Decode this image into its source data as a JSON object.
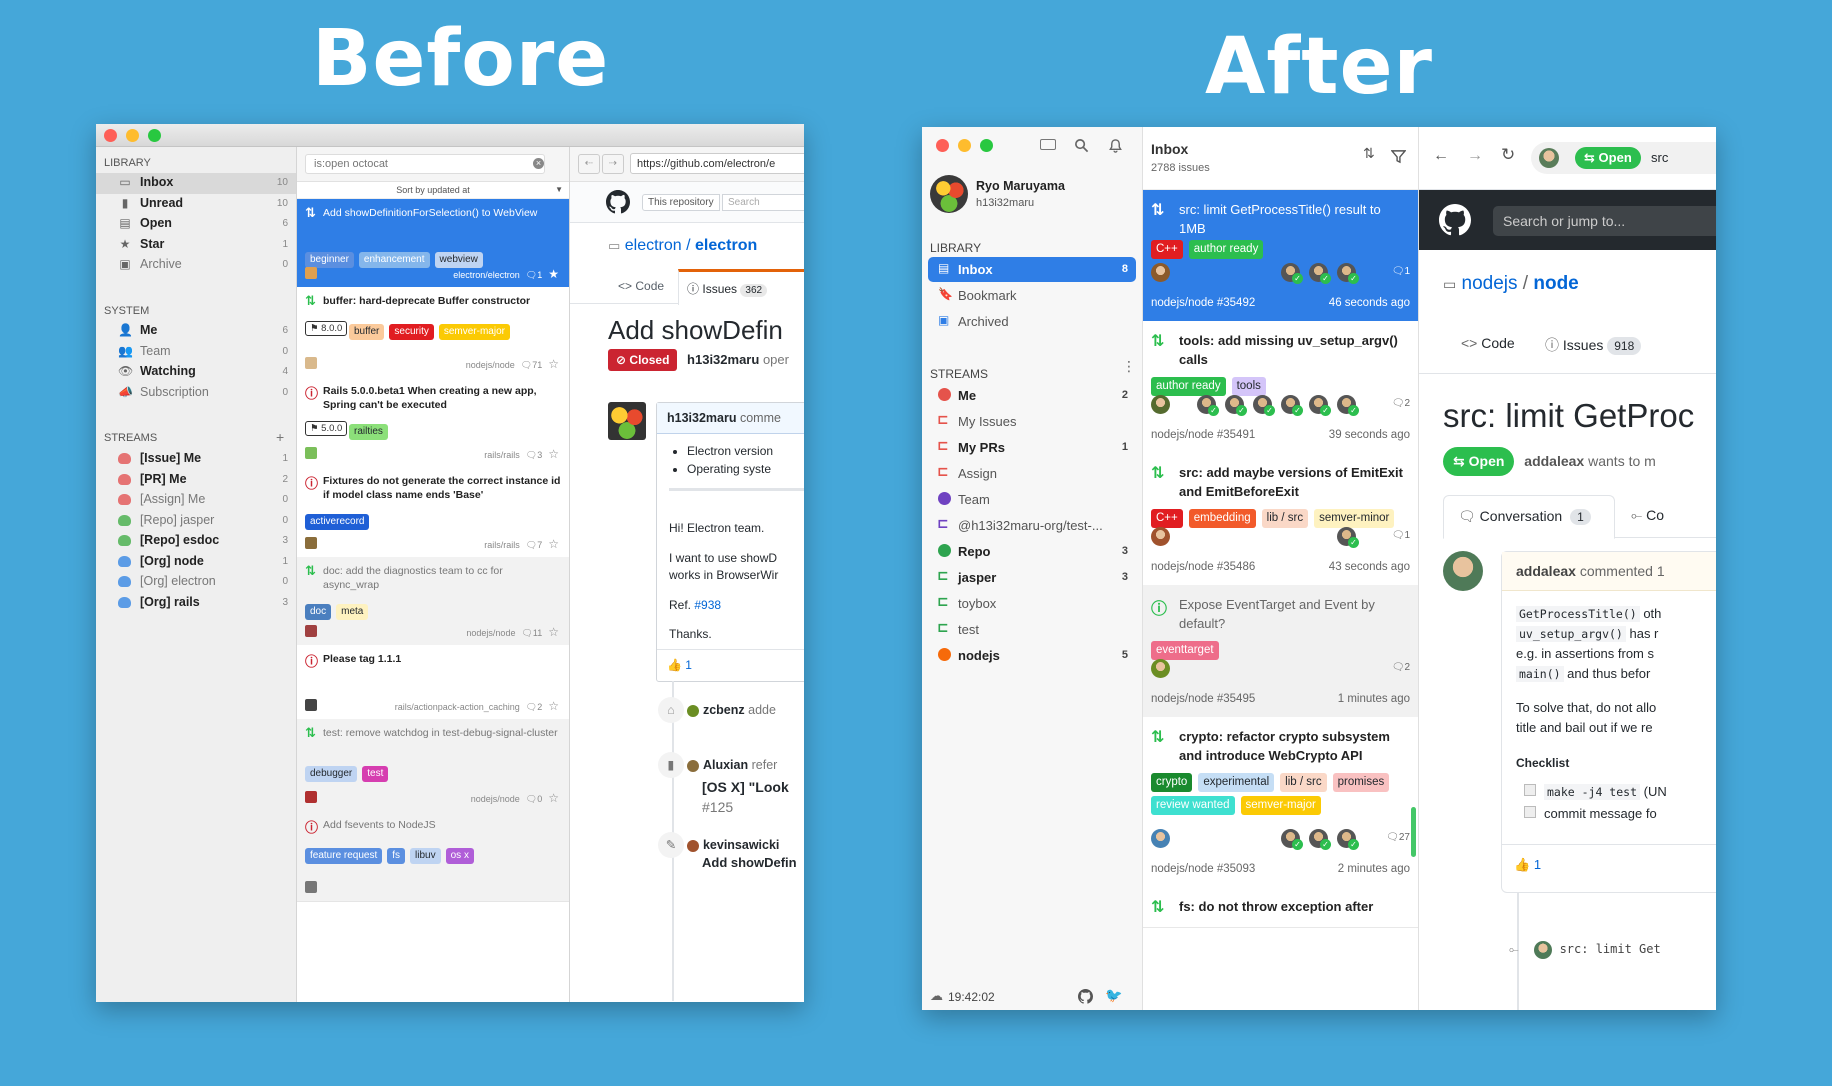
{
  "titles": {
    "before": "Before",
    "after": "After"
  },
  "before": {
    "sidebar": {
      "library_header": "LIBRARY",
      "library": [
        {
          "label": "Inbox",
          "count": "10",
          "bold": true,
          "selected": true
        },
        {
          "label": "Unread",
          "count": "10",
          "bold": true
        },
        {
          "label": "Open",
          "count": "6",
          "bold": true
        },
        {
          "label": "Star",
          "count": "1",
          "bold": true
        },
        {
          "label": "Archive",
          "count": "0",
          "bold": false
        }
      ],
      "system_header": "SYSTEM",
      "system": [
        {
          "label": "Me",
          "count": "6",
          "bold": true
        },
        {
          "label": "Team",
          "count": "0",
          "bold": false
        },
        {
          "label": "Watching",
          "count": "4",
          "bold": true
        },
        {
          "label": "Subscription",
          "count": "0",
          "bold": false
        }
      ],
      "streams_header": "STREAMS",
      "streams_add": "+",
      "streams": [
        {
          "label": "[Issue] Me",
          "count": "1",
          "bold": true,
          "color": "#e57373"
        },
        {
          "label": "[PR] Me",
          "count": "2",
          "bold": true,
          "color": "#e57373"
        },
        {
          "label": "[Assign] Me",
          "count": "0",
          "bold": false,
          "color": "#e57373"
        },
        {
          "label": "[Repo] jasper",
          "count": "0",
          "bold": false,
          "color": "#66bb6a"
        },
        {
          "label": "[Repo] esdoc",
          "count": "3",
          "bold": true,
          "color": "#66bb6a"
        },
        {
          "label": "[Org] node",
          "count": "1",
          "bold": true,
          "color": "#5c9ce6"
        },
        {
          "label": "[Org] electron",
          "count": "0",
          "bold": false,
          "color": "#5c9ce6"
        },
        {
          "label": "[Org] rails",
          "count": "3",
          "bold": true,
          "color": "#5c9ce6"
        }
      ]
    },
    "list": {
      "search_value": "is:open octocat",
      "sort_label": "Sort by updated at",
      "items": [
        {
          "title": "Add showDefinitionForSelection() to WebView",
          "selected": true,
          "labels": [
            {
              "t": "beginner",
              "c": "#5b8fe0"
            },
            {
              "t": "enhancement",
              "c": "#84b6eb"
            },
            {
              "t": "webview",
              "c": "#bfd4f2",
              "fg": "#24292e"
            }
          ],
          "repo": "electron/electron",
          "comments": "1",
          "state": "pr"
        },
        {
          "title": "buffer: hard-deprecate Buffer constructor",
          "milestone": "8.0.0",
          "labels": [
            {
              "t": "buffer",
              "c": "#fbca9b",
              "fg": "#24292e"
            },
            {
              "t": "security",
              "c": "#e11d21"
            },
            {
              "t": "semver-major",
              "c": "#fbca04"
            }
          ],
          "repo": "nodejs/node",
          "comments": "71",
          "state": "pr"
        },
        {
          "title": "Rails 5.0.0.beta1 When creating a new app, Spring can't be executed",
          "milestone": "5.0.0",
          "labels": [
            {
              "t": "railties",
              "c": "#8ce07a",
              "fg": "#24292e"
            }
          ],
          "repo": "rails/rails",
          "comments": "3",
          "state": "issue"
        },
        {
          "title": "Fixtures do not generate the correct instance id if model class name ends 'Base'",
          "labels": [
            {
              "t": "activerecord",
              "c": "#1f5fd6"
            }
          ],
          "repo": "rails/rails",
          "comments": "7",
          "state": "issue"
        },
        {
          "title": "doc: add the diagnostics team to cc for async_wrap",
          "read": true,
          "labels": [
            {
              "t": "doc",
              "c": "#4b7fbf"
            },
            {
              "t": "meta",
              "c": "#fef2c0",
              "fg": "#24292e"
            }
          ],
          "repo": "nodejs/node",
          "comments": "11",
          "state": "pr"
        },
        {
          "title": "Please tag 1.1.1",
          "labels": [],
          "repo": "rails/actionpack-action_caching",
          "comments": "2",
          "state": "issue"
        },
        {
          "title": "test: remove watchdog in test-debug-signal-cluster",
          "read": true,
          "labels": [
            {
              "t": "debugger",
              "c": "#bfd4f2",
              "fg": "#24292e"
            },
            {
              "t": "test",
              "c": "#d63eb0"
            }
          ],
          "repo": "nodejs/node",
          "comments": "0",
          "state": "pr"
        },
        {
          "title": "Add fsevents to NodeJS",
          "read": true,
          "labels": [
            {
              "t": "feature request",
              "c": "#5b8fe0"
            },
            {
              "t": "fs",
              "c": "#5b8fe0"
            },
            {
              "t": "libuv",
              "c": "#bfd4f2",
              "fg": "#24292e"
            },
            {
              "t": "os x",
              "c": "#b05ed8"
            }
          ],
          "repo": "",
          "comments": "",
          "state": "issue"
        }
      ]
    },
    "browser": {
      "url": "https://github.com/electron/e",
      "this_repo": "This repository",
      "search_ph": "Search",
      "repo_owner": "electron",
      "repo_name": "electron",
      "tab_code": "Code",
      "tab_issues": "Issues",
      "issues_count": "362",
      "issue_title": "Add showDefin",
      "state": "Closed",
      "author": "h13i32maru",
      "author_suffix": "oper",
      "comment_author": "h13i32maru",
      "comment_suffix": "comme",
      "bullets": [
        "Electron version",
        "Operating syste"
      ],
      "para1": "Hi! Electron team.",
      "para2a": "I want to use showD",
      "para2b": "works in BrowserWir",
      "ref_label": "Ref.",
      "ref_link": "#938",
      "thanks": "Thanks.",
      "reaction": "1",
      "event1_user": "zcbenz",
      "event1_text": "adde",
      "event2_user": "Aluxian",
      "event2_text": "refer",
      "event2_title": "[OS X] \"Look",
      "event2_num": "#125",
      "event3_user": "kevinsawicki",
      "event3_text": "Add showDefin"
    }
  },
  "after": {
    "sidebar": {
      "user_name": "Ryo Maruyama",
      "user_login": "h13i32maru",
      "library_header": "LIBRARY",
      "library": [
        {
          "label": "Inbox",
          "count": "8",
          "selected": true
        },
        {
          "label": "Bookmark",
          "count": ""
        },
        {
          "label": "Archived",
          "count": ""
        }
      ],
      "streams_header": "STREAMS",
      "streams": [
        {
          "label": "Me",
          "count": "2",
          "bold": true,
          "kind": "gh",
          "color": "#e5534b"
        },
        {
          "label": "My Issues",
          "count": "",
          "bold": false,
          "kind": "q",
          "color": "#e5534b"
        },
        {
          "label": "My PRs",
          "count": "1",
          "bold": true,
          "kind": "q",
          "color": "#e5534b"
        },
        {
          "label": "Assign",
          "count": "",
          "bold": false,
          "kind": "q",
          "color": "#e5534b"
        },
        {
          "label": "Team",
          "count": "",
          "bold": false,
          "kind": "gh",
          "color": "#6f42c1"
        },
        {
          "label": "@h13i32maru-org/test-...",
          "count": "",
          "bold": false,
          "kind": "q",
          "color": "#6f42c1"
        },
        {
          "label": "Repo",
          "count": "3",
          "bold": true,
          "kind": "gh",
          "color": "#2ea44f"
        },
        {
          "label": "jasper",
          "count": "3",
          "bold": true,
          "kind": "q",
          "color": "#2ea44f"
        },
        {
          "label": "toybox",
          "count": "",
          "bold": false,
          "kind": "q",
          "color": "#2ea44f"
        },
        {
          "label": "test",
          "count": "",
          "bold": false,
          "kind": "q",
          "color": "#2ea44f"
        },
        {
          "label": "nodejs",
          "count": "5",
          "bold": true,
          "kind": "gh",
          "color": "#f66a0a"
        }
      ],
      "clock": "19:42:02"
    },
    "list": {
      "title": "Inbox",
      "subtitle": "2788 issues",
      "items": [
        {
          "title": "src: limit GetProcessTitle() result to 1MB",
          "selected": true,
          "state": "pr",
          "labels": [
            {
              "t": "C++",
              "c": "#e11d21",
              "fg": "#fff"
            },
            {
              "t": "author ready",
              "c": "#2cbe4e",
              "fg": "#fff"
            }
          ],
          "ref": "nodejs/node #35492",
          "time": "46 seconds ago",
          "comments": "1",
          "reviewers": 3
        },
        {
          "title": "tools: add missing uv_setup_argv() calls",
          "state": "pr",
          "labels": [
            {
              "t": "author ready",
              "c": "#2cbe4e",
              "fg": "#fff"
            },
            {
              "t": "tools",
              "c": "#d4c5f9",
              "fg": "#24292e"
            }
          ],
          "ref": "nodejs/node #35491",
          "time": "39 seconds ago",
          "comments": "2",
          "reviewers": 6
        },
        {
          "title": "src: add maybe versions of EmitExit and EmitBeforeExit",
          "state": "pr",
          "labels": [
            {
              "t": "C++",
              "c": "#e11d21",
              "fg": "#fff"
            },
            {
              "t": "embedding",
              "c": "#f25a2a",
              "fg": "#fff"
            },
            {
              "t": "lib / src",
              "c": "#fad8c7",
              "fg": "#24292e"
            },
            {
              "t": "semver-minor",
              "c": "#fef2c0",
              "fg": "#24292e"
            }
          ],
          "ref": "nodejs/node #35486",
          "time": "43 seconds ago",
          "comments": "1",
          "reviewers": 1
        },
        {
          "title": "Expose EventTarget and Event by default?",
          "state": "issue",
          "read": true,
          "labels": [
            {
              "t": "eventtarget",
              "c": "#ee6d8a",
              "fg": "#fff"
            }
          ],
          "ref": "nodejs/node #35495",
          "time": "1 minutes ago",
          "comments": "2",
          "reviewers": 0
        },
        {
          "title": "crypto: refactor crypto subsystem and introduce WebCrypto API",
          "state": "pr",
          "labels": [
            {
              "t": "crypto",
              "c": "#1a8a2e",
              "fg": "#fff"
            },
            {
              "t": "experimental",
              "c": "#c5def5",
              "fg": "#24292e"
            },
            {
              "t": "lib / src",
              "c": "#fad8c7",
              "fg": "#24292e"
            },
            {
              "t": "promises",
              "c": "#f9c1c1",
              "fg": "#24292e"
            },
            {
              "t": "review wanted",
              "c": "#3ee0d0",
              "fg": "#fff"
            },
            {
              "t": "semver-major",
              "c": "#fbca04",
              "fg": "#fff"
            }
          ],
          "ref": "nodejs/node #35093",
          "time": "2 minutes ago",
          "comments": "27",
          "reviewers": 3
        },
        {
          "title": "fs: do not throw exception after",
          "state": "pr",
          "labels": [],
          "ref": "",
          "time": "",
          "comments": "",
          "reviewers": 0
        }
      ]
    },
    "browser": {
      "pill_state": "Open",
      "pill_suffix": "src",
      "gh_search": "Search or jump to...",
      "repo_owner": "nodejs",
      "repo_name": "node",
      "tab_code": "Code",
      "tab_issues": "Issues",
      "issues_count": "918",
      "issue_title": "src: limit GetProc",
      "state": "Open",
      "author": "addaleax",
      "author_suffix": "wants to m",
      "tab_conversation": "Conversation",
      "conversation_count": "1",
      "tab_commits": "Co",
      "comment_author": "addaleax",
      "comment_suffix": "commented 1",
      "code1": "GetProcessTitle()",
      "text1": "oth",
      "code2": "uv_setup_argv()",
      "text2": "has r",
      "text3": "e.g. in assertions from s",
      "code3": "main()",
      "text4": "and thus befor",
      "para1": "To solve that, do not allo",
      "para2": "title and bail out if we re",
      "checklist_title": "Checklist",
      "check1_code": "make -j4 test",
      "check1_text": "(UN",
      "check2_text": "commit message fo",
      "reaction": "1",
      "commit_text": "src: limit Get"
    }
  },
  "colors": {
    "background": "#45a7d9",
    "selected_blue": "#2f7ee6",
    "gh_dark": "#24292e",
    "open_green": "#2cbe4e",
    "closed_red": "#cb2431"
  }
}
